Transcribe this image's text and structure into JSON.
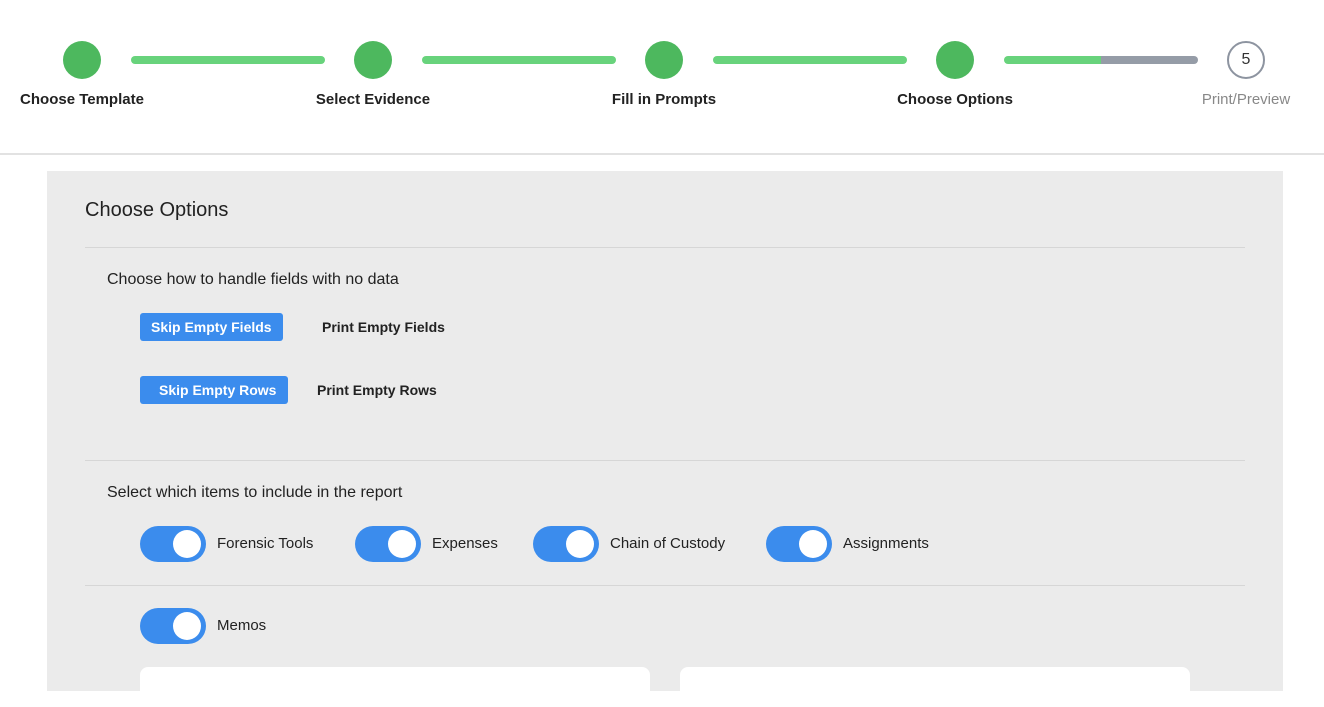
{
  "stepper": {
    "steps": [
      {
        "label": "Choose Template",
        "status": "complete"
      },
      {
        "label": "Select Evidence",
        "status": "complete"
      },
      {
        "label": "Fill in Prompts",
        "status": "complete"
      },
      {
        "label": "Choose Options",
        "status": "complete"
      },
      {
        "label": "Print/Preview",
        "number": "5",
        "status": "pending"
      }
    ],
    "colors": {
      "complete": "#4db85e",
      "pending": "#959ca7"
    }
  },
  "panel": {
    "title": "Choose Options",
    "empty_section": {
      "heading": "Choose how to handle fields with no data",
      "skip_fields": "Skip Empty Fields",
      "print_fields": "Print Empty Fields",
      "skip_rows": "Skip Empty Rows",
      "print_rows": "Print Empty Rows"
    },
    "items_section": {
      "heading": "Select which items to include in the report",
      "toggles": [
        {
          "label": "Forensic Tools",
          "on": true
        },
        {
          "label": "Expenses",
          "on": true
        },
        {
          "label": "Chain of Custody",
          "on": true
        },
        {
          "label": "Assignments",
          "on": true
        },
        {
          "label": "Memos",
          "on": true
        }
      ]
    },
    "accent": "#3b8ced"
  }
}
